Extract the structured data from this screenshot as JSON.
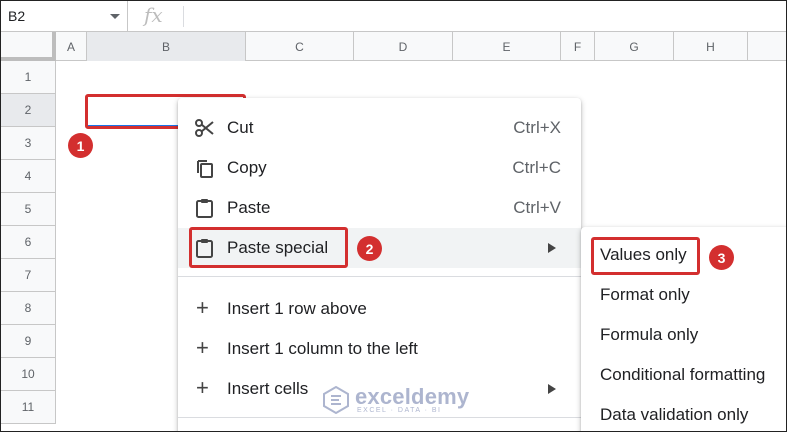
{
  "formula_bar": {
    "name_box": "B2",
    "fx_label": "fx"
  },
  "columns": [
    "A",
    "B",
    "C",
    "D",
    "E",
    "F",
    "G",
    "H"
  ],
  "rows": [
    "1",
    "2",
    "3",
    "4",
    "5",
    "6",
    "7",
    "8",
    "9",
    "10",
    "11"
  ],
  "selected": {
    "column": "B",
    "row": "2"
  },
  "context_menu": {
    "items": [
      {
        "label": "Cut",
        "shortcut": "Ctrl+X",
        "icon": "scissors-icon"
      },
      {
        "label": "Copy",
        "shortcut": "Ctrl+C",
        "icon": "copy-icon"
      },
      {
        "label": "Paste",
        "shortcut": "Ctrl+V",
        "icon": "clipboard-icon"
      },
      {
        "label": "Paste special",
        "shortcut": "",
        "icon": "clipboard-icon"
      },
      {
        "label": "Insert 1 row above",
        "shortcut": "",
        "icon": "plus-icon"
      },
      {
        "label": "Insert 1 column to the left",
        "shortcut": "",
        "icon": "plus-icon"
      },
      {
        "label": "Insert cells",
        "shortcut": "",
        "icon": "plus-icon"
      }
    ]
  },
  "submenu": {
    "items": [
      {
        "label": "Values only"
      },
      {
        "label": "Format only"
      },
      {
        "label": "Formula only"
      },
      {
        "label": "Conditional formatting"
      },
      {
        "label": "Data validation only"
      }
    ]
  },
  "steps": [
    "1",
    "2",
    "3"
  ],
  "watermark": {
    "name": "exceldemy",
    "tagline": "EXCEL · DATA · BI"
  },
  "colors": {
    "highlight": "#d32f2f",
    "selection": "#1a73e8",
    "header_bg": "#f8f9fa"
  }
}
